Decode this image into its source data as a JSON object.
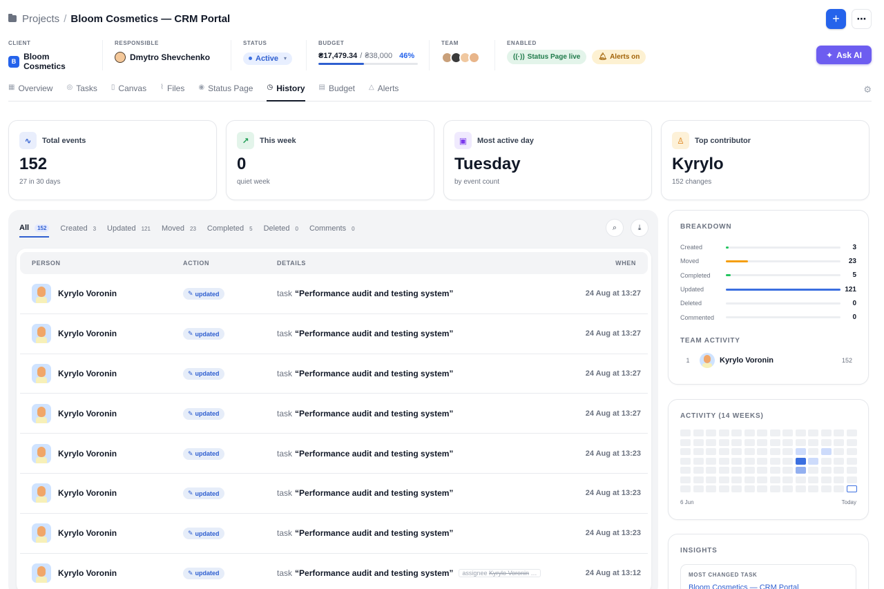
{
  "breadcrumb": {
    "root": "Projects",
    "separator": "/",
    "current": "Bloom Cosmetics — CRM Portal"
  },
  "toolbar": {
    "add_icon": "plus-icon",
    "more_icon": "more-icon",
    "ask_ai": "Ask AI"
  },
  "meta": {
    "client": {
      "label": "CLIENT",
      "initial": "B",
      "value": "Bloom Cosmetics"
    },
    "responsible": {
      "label": "RESPONSIBLE",
      "value": "Dmytro Shevchenko"
    },
    "status": {
      "label": "STATUS",
      "value": "Active"
    },
    "budget": {
      "label": "BUDGET",
      "spent": "₴17,479.34",
      "sep": "/",
      "total": "₴38,000",
      "percent": "46%",
      "progress": 0.46
    },
    "team": {
      "label": "TEAM"
    },
    "enabled": {
      "label": "ENABLED",
      "status_page": "Status Page live",
      "alerts": "Alerts on"
    }
  },
  "tabs": [
    {
      "label": "Overview",
      "icon": "grid-icon"
    },
    {
      "label": "Tasks",
      "icon": "check-circle-icon"
    },
    {
      "label": "Canvas",
      "icon": "book-icon"
    },
    {
      "label": "Files",
      "icon": "paperclip-icon"
    },
    {
      "label": "Status Page",
      "icon": "broadcast-icon"
    },
    {
      "label": "History",
      "icon": "clock-icon",
      "active": true
    },
    {
      "label": "Budget",
      "icon": "wallet-icon"
    },
    {
      "label": "Alerts",
      "icon": "bell-icon"
    }
  ],
  "stats": [
    {
      "label": "Total events",
      "value": "152",
      "sub": "27 in 30 days",
      "icon": "pulse-icon",
      "color": "#2f5fd0",
      "bg": "#e9eefc"
    },
    {
      "label": "This week",
      "value": "0",
      "sub": "quiet week",
      "icon": "trend-up-icon",
      "color": "#1f9d55",
      "bg": "#e3f4ea"
    },
    {
      "label": "Most active day",
      "value": "Tuesday",
      "sub": "by event count",
      "icon": "calendar-icon",
      "color": "#7c3aed",
      "bg": "#f0eafe"
    },
    {
      "label": "Top contributor",
      "value": "Kyrylo",
      "sub": "152 changes",
      "icon": "user-icon",
      "color": "#d97706",
      "bg": "#fdf1d8"
    }
  ],
  "filters": [
    {
      "label": "All",
      "count": "152",
      "active": true
    },
    {
      "label": "Created",
      "count": "3"
    },
    {
      "label": "Updated",
      "count": "121"
    },
    {
      "label": "Moved",
      "count": "23"
    },
    {
      "label": "Completed",
      "count": "5"
    },
    {
      "label": "Deleted",
      "count": "0"
    },
    {
      "label": "Comments",
      "count": "0"
    }
  ],
  "table": {
    "headers": {
      "person": "PERSON",
      "action": "ACTION",
      "details": "DETAILS",
      "when": "WHEN"
    },
    "rows": [
      {
        "person": "Kyrylo Voronin",
        "action": "updated",
        "kind": "task",
        "name": "“Performance audit and testing system”",
        "when": "24 Aug at 13:27"
      },
      {
        "person": "Kyrylo Voronin",
        "action": "updated",
        "kind": "task",
        "name": "“Performance audit and testing system”",
        "when": "24 Aug at 13:27"
      },
      {
        "person": "Kyrylo Voronin",
        "action": "updated",
        "kind": "task",
        "name": "“Performance audit and testing system”",
        "when": "24 Aug at 13:27"
      },
      {
        "person": "Kyrylo Voronin",
        "action": "updated",
        "kind": "task",
        "name": "“Performance audit and testing system”",
        "when": "24 Aug at 13:27"
      },
      {
        "person": "Kyrylo Voronin",
        "action": "updated",
        "kind": "task",
        "name": "“Performance audit and testing system”",
        "when": "24 Aug at 13:23"
      },
      {
        "person": "Kyrylo Voronin",
        "action": "updated",
        "kind": "task",
        "name": "“Performance audit and testing system”",
        "when": "24 Aug at 13:23"
      },
      {
        "person": "Kyrylo Voronin",
        "action": "updated",
        "kind": "task",
        "name": "“Performance audit and testing system”",
        "when": "24 Aug at 13:23"
      },
      {
        "person": "Kyrylo Voronin",
        "action": "updated",
        "kind": "task",
        "name": "“Performance audit and testing system”",
        "when": "24 Aug at 13:12",
        "extra": "assignee",
        "extra_old": "Kyrylo Voronin",
        "extra_more": "…"
      }
    ]
  },
  "breakdown": {
    "title": "BREAKDOWN",
    "rows": [
      {
        "label": "Created",
        "value": 3,
        "color": "#22c55e"
      },
      {
        "label": "Moved",
        "value": 23,
        "color": "#f59e0b"
      },
      {
        "label": "Completed",
        "value": 5,
        "color": "#22c55e"
      },
      {
        "label": "Updated",
        "value": 121,
        "color": "#3b6fe0"
      },
      {
        "label": "Deleted",
        "value": 0,
        "color": "#ef4444"
      },
      {
        "label": "Commented",
        "value": 0,
        "color": "#8b5cf6"
      }
    ]
  },
  "team_activity": {
    "title": "TEAM ACTIVITY",
    "members": [
      {
        "rank": "1",
        "name": "Kyrylo Voronin",
        "count": "152"
      }
    ]
  },
  "activity": {
    "title": "ACTIVITY (14 WEEKS)",
    "start": "6 Jun",
    "end": "Today",
    "cells": [
      {
        "col": 9,
        "row": 2,
        "level": 1
      },
      {
        "col": 11,
        "row": 2,
        "level": 1
      },
      {
        "col": 9,
        "row": 3,
        "level": 3
      },
      {
        "col": 10,
        "row": 3,
        "level": 1
      },
      {
        "col": 9,
        "row": 4,
        "level": 2
      },
      {
        "col": 13,
        "row": 6,
        "level": "today"
      }
    ]
  },
  "insights": {
    "title": "INSIGHTS",
    "most_changed_label": "MOST CHANGED TASK",
    "most_changed_value": "Bloom Cosmetics — CRM Portal"
  }
}
